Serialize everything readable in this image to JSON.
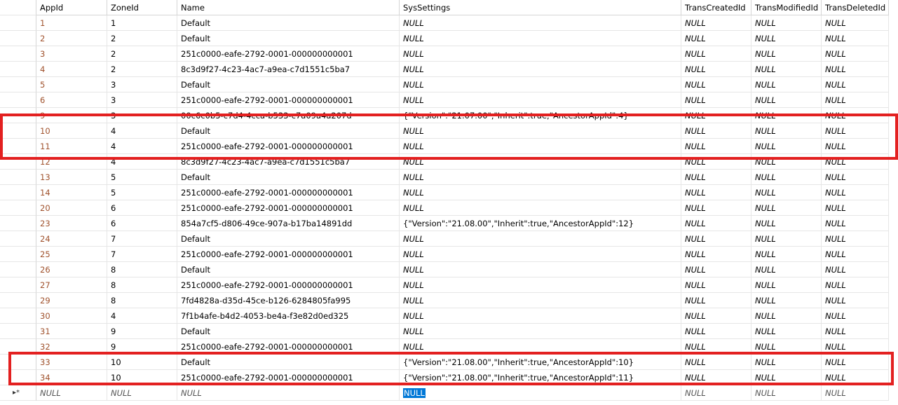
{
  "columns": [
    "AppId",
    "ZoneId",
    "Name",
    "SysSettings",
    "TransCreatedId",
    "TransModifiedId",
    "TransDeletedId"
  ],
  "rows": [
    [
      "1",
      "1",
      "Default",
      "NULL",
      "NULL",
      "NULL",
      "NULL"
    ],
    [
      "2",
      "2",
      "Default",
      "NULL",
      "NULL",
      "NULL",
      "NULL"
    ],
    [
      "3",
      "2",
      "251c0000-eafe-2792-0001-000000000001",
      "NULL",
      "NULL",
      "NULL",
      "NULL"
    ],
    [
      "4",
      "2",
      "8c3d9f27-4c23-4ac7-a9ea-c7d1551c5ba7",
      "NULL",
      "NULL",
      "NULL",
      "NULL"
    ],
    [
      "5",
      "3",
      "Default",
      "NULL",
      "NULL",
      "NULL",
      "NULL"
    ],
    [
      "6",
      "3",
      "251c0000-eafe-2792-0001-000000000001",
      "NULL",
      "NULL",
      "NULL",
      "NULL"
    ],
    [
      "9",
      "3",
      "00c6c0b5-c7d4-4cca-b533-c7a09a4a207d",
      "{\"Version\":\"21.07.00\",\"Inherit\":true,\"AncestorAppId\":4}",
      "NULL",
      "NULL",
      "NULL"
    ],
    [
      "10",
      "4",
      "Default",
      "NULL",
      "NULL",
      "NULL",
      "NULL"
    ],
    [
      "11",
      "4",
      "251c0000-eafe-2792-0001-000000000001",
      "NULL",
      "NULL",
      "NULL",
      "NULL"
    ],
    [
      "12",
      "4",
      "8c3d9f27-4c23-4ac7-a9ea-c7d1551c5ba7",
      "NULL",
      "NULL",
      "NULL",
      "NULL"
    ],
    [
      "13",
      "5",
      "Default",
      "NULL",
      "NULL",
      "NULL",
      "NULL"
    ],
    [
      "14",
      "5",
      "251c0000-eafe-2792-0001-000000000001",
      "NULL",
      "NULL",
      "NULL",
      "NULL"
    ],
    [
      "20",
      "6",
      "251c0000-eafe-2792-0001-000000000001",
      "NULL",
      "NULL",
      "NULL",
      "NULL"
    ],
    [
      "23",
      "6",
      "854a7cf5-d806-49ce-907a-b17ba14891dd",
      "{\"Version\":\"21.08.00\",\"Inherit\":true,\"AncestorAppId\":12}",
      "NULL",
      "NULL",
      "NULL"
    ],
    [
      "24",
      "7",
      "Default",
      "NULL",
      "NULL",
      "NULL",
      "NULL"
    ],
    [
      "25",
      "7",
      "251c0000-eafe-2792-0001-000000000001",
      "NULL",
      "NULL",
      "NULL",
      "NULL"
    ],
    [
      "26",
      "8",
      "Default",
      "NULL",
      "NULL",
      "NULL",
      "NULL"
    ],
    [
      "27",
      "8",
      "251c0000-eafe-2792-0001-000000000001",
      "NULL",
      "NULL",
      "NULL",
      "NULL"
    ],
    [
      "29",
      "8",
      "7fd4828a-d35d-45ce-b126-6284805fa995",
      "NULL",
      "NULL",
      "NULL",
      "NULL"
    ],
    [
      "30",
      "4",
      "7f1b4afe-b4d2-4053-be4a-f3e82d0ed325",
      "NULL",
      "NULL",
      "NULL",
      "NULL"
    ],
    [
      "31",
      "9",
      "Default",
      "NULL",
      "NULL",
      "NULL",
      "NULL"
    ],
    [
      "32",
      "9",
      "251c0000-eafe-2792-0001-000000000001",
      "NULL",
      "NULL",
      "NULL",
      "NULL"
    ],
    [
      "33",
      "10",
      "Default",
      "{\"Version\":\"21.08.00\",\"Inherit\":true,\"AncestorAppId\":10}",
      "NULL",
      "NULL",
      "NULL"
    ],
    [
      "34",
      "10",
      "251c0000-eafe-2792-0001-000000000001",
      "{\"Version\":\"21.08.00\",\"Inherit\":true,\"AncestorAppId\":11}",
      "NULL",
      "NULL",
      "NULL"
    ]
  ],
  "new_row": {
    "marker": "▸*",
    "values": [
      "NULL",
      "NULL",
      "NULL",
      "NULL",
      "NULL",
      "NULL",
      "NULL"
    ]
  },
  "colors": {
    "highlight": "#e32020",
    "selection": "#0078d7",
    "id_text": "#a0522d"
  }
}
